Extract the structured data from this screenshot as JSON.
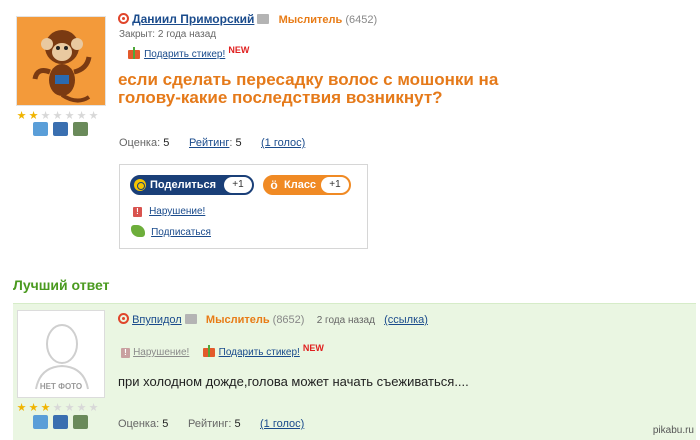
{
  "question": {
    "author_name": "Даниил Приморский",
    "rank": "Мыслитель",
    "rank_points": "(6452)",
    "closed_text": "Закрыт: 2 года назад",
    "gift_link": "Подарить стикер!",
    "new_badge": "NEW",
    "title": "если сделать пересадку волос с мошонки на голову-какие последствия возникнут?",
    "stars_on": 2,
    "stars_total": 7,
    "score_label": "Оценка:",
    "score_value": "5",
    "rating_label": "Рейтинг",
    "rating_value": "5",
    "votes_link": "(1 голос)"
  },
  "share": {
    "share_label": "Поделиться",
    "share_count": "+1",
    "class_label": "Класс",
    "class_count": "+1",
    "report_link": "Нарушение!",
    "subscribe_link": "Подписаться"
  },
  "best_answer": {
    "heading": "Лучший ответ",
    "author_name": "Впупидол",
    "rank": "Мыслитель",
    "rank_points": "(8652)",
    "time_ago": "2 года назад",
    "link": "(ссылка)",
    "report_link": "Нарушение!",
    "gift_link": "Подарить стикер!",
    "new_badge": "NEW",
    "text": "при холодном дожде,голова может начать съеживаться....",
    "nophoto": "НЕТ ФОТО",
    "stars_on": 3,
    "stars_total": 7,
    "score_label": "Оценка:",
    "score_value": "5",
    "rating_label": "Рейтинг:",
    "rating_value": "5",
    "votes_link": "(1 голос)"
  },
  "watermark": "pikabu.ru",
  "colors": {
    "link_blue": "#1a4b8c",
    "rank_orange": "#e87c17",
    "title_orange": "#e57a1a",
    "best_green": "#4a9a1f",
    "answer_bg": "#eaf6e2"
  }
}
